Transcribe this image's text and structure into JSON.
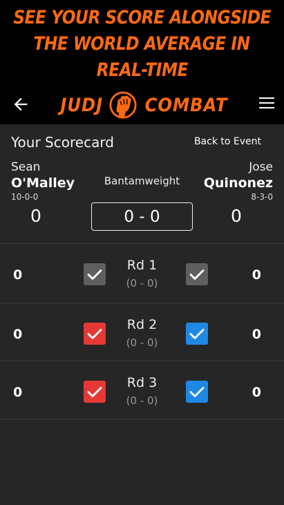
{
  "promo": {
    "lines": [
      "SEE YOUR SCORE ALONGSIDE",
      "THE WORLD AVERAGE IN",
      "REAL-TIME"
    ]
  },
  "appbar": {
    "back_icon": "arrow-left-icon",
    "menu_icon": "hamburger-menu-icon",
    "logo_left": "JUDJ",
    "logo_right": "COMBAT",
    "logo_icon": "raised-fist-icon"
  },
  "scorecard": {
    "title": "Your Scorecard",
    "back_link": "Back to Event",
    "weight_class": "Bantamweight",
    "total": "0 - 0",
    "left_fighter": {
      "first": "Sean",
      "last": "O'Malley",
      "record": "10-0-0",
      "score": "0"
    },
    "right_fighter": {
      "first": "Jose",
      "last": "Quinonez",
      "record": "8-3-0",
      "score": "0"
    }
  },
  "rounds": [
    {
      "label": "Rd 1",
      "sub": "(0 - 0)",
      "left_score": "0",
      "right_score": "0",
      "left_color": "#5f5f5f",
      "right_color": "#5f5f5f"
    },
    {
      "label": "Rd 2",
      "sub": "(0 - 0)",
      "left_score": "0",
      "right_score": "0",
      "left_color": "#e53935",
      "right_color": "#1e88e5"
    },
    {
      "label": "Rd 3",
      "sub": "(0 - 0)",
      "left_score": "0",
      "right_score": "0",
      "left_color": "#e53935",
      "right_color": "#1e88e5"
    }
  ],
  "colors": {
    "accent": "#ff6a10",
    "background": "#262626",
    "header": "#000000"
  }
}
